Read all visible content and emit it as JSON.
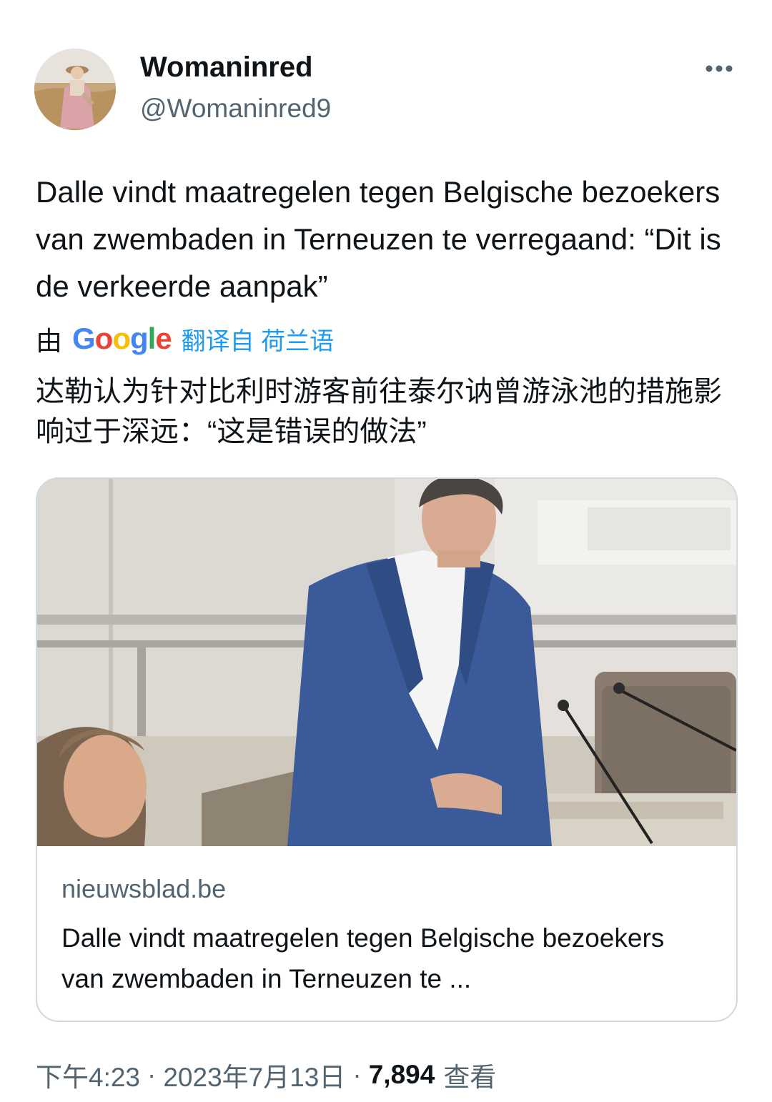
{
  "author": {
    "display_name": "Womaninred",
    "handle": "@Womaninred9",
    "avatar_icon": "avatar-photo"
  },
  "more_icon": "more-horizontal-icon",
  "tweet": {
    "text": "Dalle vindt maatregelen tegen Belgische bezoekers van zwembaden in Terneuzen te verregaand: “Dit is de verkeerde aanpak”",
    "translation": {
      "by_label": "由",
      "provider": "Google",
      "translated_from": "翻译自 荷兰语",
      "text": "达勒认为针对比利时游客前往泰尔讷曾游泳池的措施影响过于深远：“这是错误的做法”"
    }
  },
  "link_card": {
    "domain": "nieuwsblad.be",
    "title": "Dalle vindt maatregelen tegen Belgische bezoekers van zwembaden in Terneuzen te ..."
  },
  "meta": {
    "time": "下午4:23",
    "separator": "·",
    "date": "2023年7月13日",
    "views_count": "7,894",
    "views_label": "查看"
  },
  "colors": {
    "text_primary": "#0f1419",
    "text_secondary": "#536471",
    "link_blue": "#1d9bf0",
    "card_border": "#cfd9de"
  }
}
